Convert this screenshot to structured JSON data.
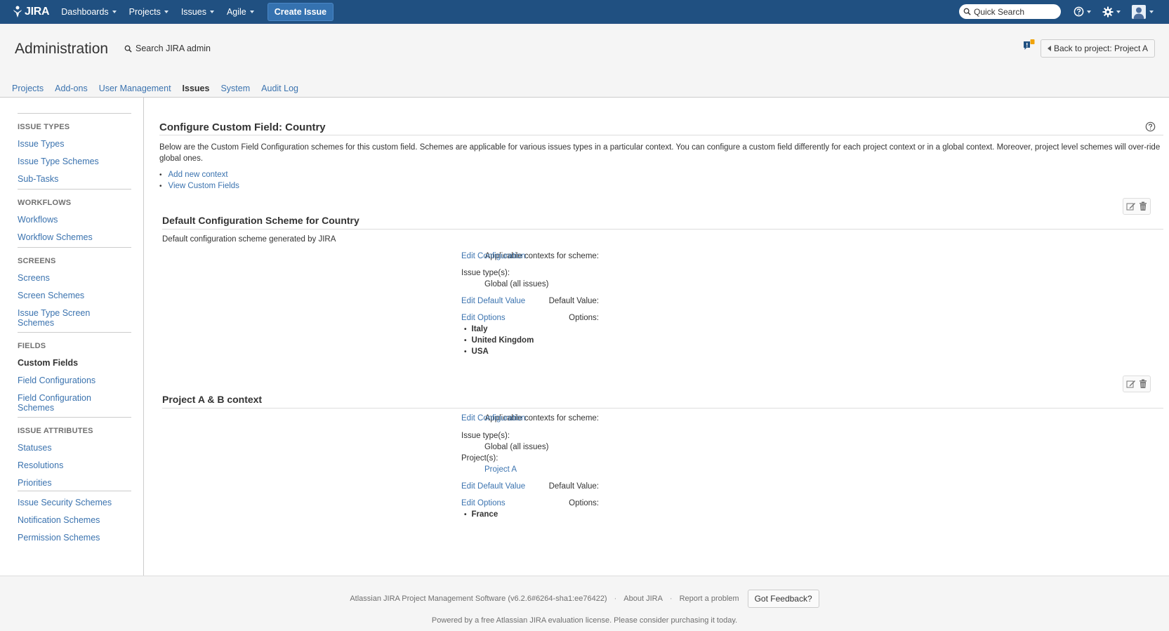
{
  "topbar": {
    "logo_text": "JIRA",
    "nav": [
      "Dashboards",
      "Projects",
      "Issues",
      "Agile"
    ],
    "create_label": "Create Issue",
    "quick_search_placeholder": "Quick Search"
  },
  "admin": {
    "title": "Administration",
    "search_placeholder": "Search JIRA admin",
    "back_label": "Back to project: Project A",
    "tabs": [
      "Projects",
      "Add-ons",
      "User Management",
      "Issues",
      "System",
      "Audit Log"
    ],
    "active_tab": "Issues"
  },
  "sidebar": {
    "groups": [
      {
        "heading": "Issue Types",
        "items": [
          "Issue Types",
          "Issue Type Schemes",
          "Sub-Tasks"
        ]
      },
      {
        "heading": "Workflows",
        "items": [
          "Workflows",
          "Workflow Schemes"
        ]
      },
      {
        "heading": "Screens",
        "items": [
          "Screens",
          "Screen Schemes",
          "Issue Type Screen Schemes"
        ]
      },
      {
        "heading": "Fields",
        "items": [
          "Custom Fields",
          "Field Configurations",
          "Field Configuration Schemes"
        ]
      },
      {
        "heading": "Issue Attributes",
        "items": [
          "Statuses",
          "Resolutions",
          "Priorities"
        ]
      },
      {
        "heading": "",
        "items": [
          "Issue Security Schemes",
          "Notification Schemes",
          "Permission Schemes"
        ]
      }
    ],
    "active_item": "Custom Fields"
  },
  "main": {
    "heading": "Configure Custom Field: Country",
    "description": "Below are the Custom Field Configuration schemes for this custom field. Schemes are applicable for various issues types in a particular context. You can configure a custom field differently for each project context or in a global context. Moreover, project level schemes will over-ride global ones.",
    "links": [
      "Add new context",
      "View Custom Fields"
    ],
    "schemes": [
      {
        "title": "Default Configuration Scheme for Country",
        "description": "Default configuration scheme generated by JIRA",
        "contexts_label": "Applicable contexts for scheme:",
        "edit_config": "Edit Configuration",
        "issue_types_label": "Issue type(s):",
        "issue_types_value": "Global (all issues)",
        "default_label": "Default Value:",
        "edit_default": "Edit Default Value",
        "options_label": "Options:",
        "edit_options": "Edit Options",
        "options": [
          "Italy",
          "United Kingdom",
          "USA"
        ]
      },
      {
        "title": "Project A & B context",
        "description": "",
        "contexts_label": "Applicable contexts for scheme:",
        "edit_config": "Edit Configuration",
        "issue_types_label": "Issue type(s):",
        "issue_types_value": "Global (all issues)",
        "projects_label": "Project(s):",
        "projects_value": "Project A",
        "default_label": "Default Value:",
        "edit_default": "Edit Default Value",
        "options_label": "Options:",
        "edit_options": "Edit Options",
        "options": [
          "France"
        ]
      }
    ]
  },
  "footer": {
    "version": "Atlassian JIRA Project Management Software (v6.2.6#6264-sha1:ee76422)",
    "about": "About JIRA",
    "report": "Report a problem",
    "feedback": "Got Feedback?",
    "license": "Powered by a free Atlassian JIRA evaluation license. Please consider purchasing it today."
  },
  "colors": {
    "topbar": "#205081",
    "link": "#3b73af",
    "create_button": "#3572b0"
  }
}
